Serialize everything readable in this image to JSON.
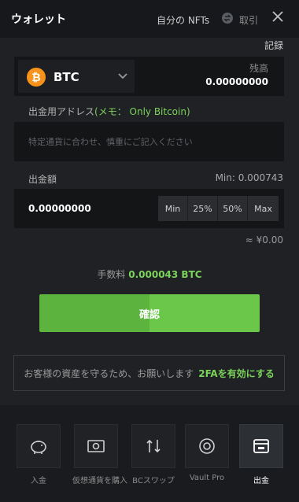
{
  "header": {
    "title": "ウォレット",
    "my_nfts": "自分の NFTs",
    "transactions": "取引"
  },
  "record_label": "記録",
  "balance": {
    "currency": "BTC",
    "label": "残高",
    "value": "0.00000000"
  },
  "address": {
    "label": "出金用アドレス",
    "memo": "(メモ： Only Bitcoin)",
    "placeholder": "特定通貨に合わせ、慎重にご記入ください"
  },
  "amount": {
    "label": "出金額",
    "min_text": "Min: 0.000743",
    "value": "0.00000000",
    "buttons": [
      "Min",
      "25%",
      "50%",
      "Max"
    ],
    "fiat": "≈ ¥0.00"
  },
  "fee": {
    "label": "手数料",
    "value": "0.000043 BTC"
  },
  "confirm_label": "確認",
  "twofa": {
    "text": "お客様の資産を守るため、お願いします",
    "link": "2FAを有効にする"
  },
  "bottom_nav": [
    {
      "label": "入金",
      "icon": "piggy-bank-icon"
    },
    {
      "label": "仮想通貨を購入",
      "icon": "banknote-icon"
    },
    {
      "label": "BCスワップ",
      "icon": "swap-icon"
    },
    {
      "label": "Vault Pro",
      "icon": "vault-icon"
    },
    {
      "label": "出金",
      "icon": "withdraw-icon"
    }
  ],
  "colors": {
    "accent_green": "#7bd35a",
    "button_green": "#5cb33d",
    "btc_orange": "#f7931a",
    "background": "#1f2124"
  }
}
